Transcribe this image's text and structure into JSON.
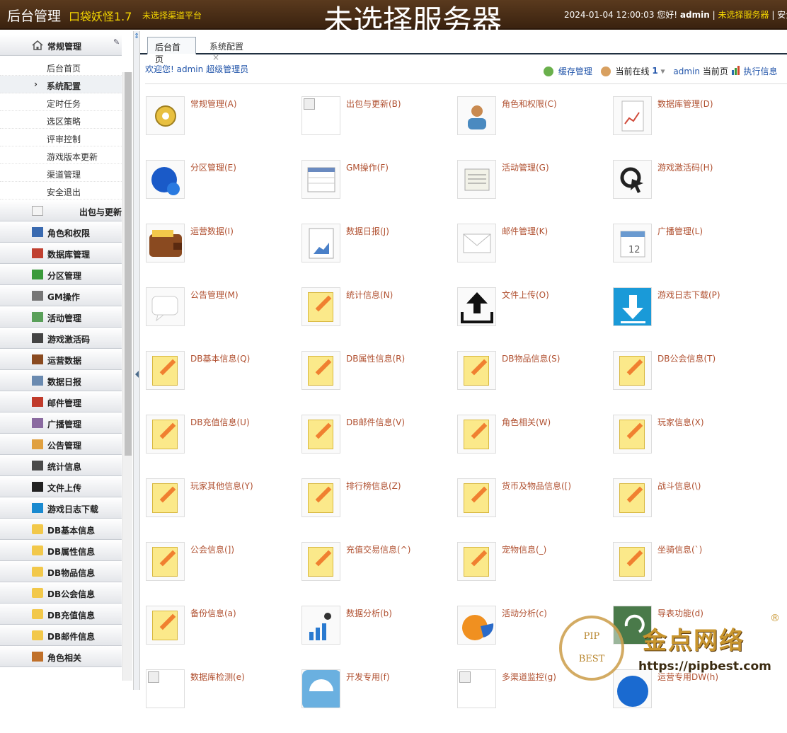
{
  "header": {
    "title": "后台管理",
    "game": "口袋妖怪1.7",
    "channel": "未选择渠道平台",
    "server": "未选择服务器",
    "datetime": "2024-01-04 12:00:03",
    "greeting": "您好!",
    "user": "admin",
    "server_link": "未选择服务器",
    "safe_exit": "安全退"
  },
  "sidebar": {
    "top_group": {
      "label": "常规管理",
      "icon": "home-icon"
    },
    "sub_items": [
      {
        "label": "后台首页",
        "active": false
      },
      {
        "label": "系统配置",
        "active": true
      },
      {
        "label": "定时任务",
        "active": false
      },
      {
        "label": "选区策略",
        "active": false
      },
      {
        "label": "评审控制",
        "active": false
      },
      {
        "label": "游戏版本更新",
        "active": false
      },
      {
        "label": "渠道管理",
        "active": false
      },
      {
        "label": "安全退出",
        "active": false
      }
    ],
    "groups": [
      {
        "label": "出包与更新",
        "icon": "broken-image-icon"
      },
      {
        "label": "角色和权限",
        "icon": "monitor-icon"
      },
      {
        "label": "数据库管理",
        "icon": "database-icon"
      },
      {
        "label": "分区管理",
        "icon": "upload-icon"
      },
      {
        "label": "GM操作",
        "icon": "gm-icon"
      },
      {
        "label": "活动管理",
        "icon": "activity-icon"
      },
      {
        "label": "游戏激活码",
        "icon": "search-icon"
      },
      {
        "label": "运营数据",
        "icon": "wallet-icon"
      },
      {
        "label": "数据日报",
        "icon": "report-icon"
      },
      {
        "label": "邮件管理",
        "icon": "mail-icon"
      },
      {
        "label": "广播管理",
        "icon": "speaker-icon"
      },
      {
        "label": "公告管理",
        "icon": "notice-icon"
      },
      {
        "label": "统计信息",
        "icon": "stats-icon"
      },
      {
        "label": "文件上传",
        "icon": "file-upload-icon"
      },
      {
        "label": "游戏日志下载",
        "icon": "download-icon"
      },
      {
        "label": "DB基本信息",
        "icon": "folder-icon"
      },
      {
        "label": "DB属性信息",
        "icon": "folder-icon"
      },
      {
        "label": "DB物品信息",
        "icon": "folder-icon"
      },
      {
        "label": "DB公会信息",
        "icon": "folder-icon"
      },
      {
        "label": "DB充值信息",
        "icon": "folder-icon"
      },
      {
        "label": "DB邮件信息",
        "icon": "folder-icon"
      },
      {
        "label": "角色相关",
        "icon": "pencil-icon"
      }
    ]
  },
  "tabs": {
    "active": "后台首页",
    "other": "系统配置",
    "close": "×"
  },
  "welcome": {
    "text": "欢迎您!",
    "user": "admin",
    "role": "超级管理员"
  },
  "toolbar": {
    "cache": "缓存管理",
    "online_label": "当前在线",
    "online_count": "1",
    "admin": "admin",
    "current_page": "当前页",
    "exec_info": "执行信息"
  },
  "grid": [
    {
      "label": "常规管理(A)",
      "icon": "gears-icon"
    },
    {
      "label": "出包与更新(B)",
      "icon": "broken-image-icon"
    },
    {
      "label": "角色和权限(C)",
      "icon": "user-icon"
    },
    {
      "label": "数据库管理(D)",
      "icon": "document-chart-icon"
    },
    {
      "label": "分区管理(E)",
      "icon": "globe-icon"
    },
    {
      "label": "GM操作(F)",
      "icon": "table-icon"
    },
    {
      "label": "活动管理(G)",
      "icon": "newspaper-icon"
    },
    {
      "label": "游戏激活码(H)",
      "icon": "cursor-icon"
    },
    {
      "label": "运营数据(I)",
      "icon": "wallet-icon"
    },
    {
      "label": "数据日报(J)",
      "icon": "report-icon"
    },
    {
      "label": "邮件管理(K)",
      "icon": "envelope-icon"
    },
    {
      "label": "广播管理(L)",
      "icon": "calendar-icon"
    },
    {
      "label": "公告管理(M)",
      "icon": "chat-icon"
    },
    {
      "label": "统计信息(N)",
      "icon": "note-icon"
    },
    {
      "label": "文件上传(O)",
      "icon": "upload-icon"
    },
    {
      "label": "游戏日志下载(P)",
      "icon": "download-icon"
    },
    {
      "label": "DB基本信息(Q)",
      "icon": "note-icon"
    },
    {
      "label": "DB属性信息(R)",
      "icon": "note-icon"
    },
    {
      "label": "DB物品信息(S)",
      "icon": "note-icon"
    },
    {
      "label": "DB公会信息(T)",
      "icon": "note-icon"
    },
    {
      "label": "DB充值信息(U)",
      "icon": "note-icon"
    },
    {
      "label": "DB邮件信息(V)",
      "icon": "note-icon"
    },
    {
      "label": "角色相关(W)",
      "icon": "note-icon"
    },
    {
      "label": "玩家信息(X)",
      "icon": "note-icon"
    },
    {
      "label": "玩家其他信息(Y)",
      "icon": "note-icon"
    },
    {
      "label": "排行榜信息(Z)",
      "icon": "note-icon"
    },
    {
      "label": "货币及物品信息([)",
      "icon": "note-icon"
    },
    {
      "label": "战斗信息(\\)",
      "icon": "note-icon"
    },
    {
      "label": "公会信息(])",
      "icon": "note-icon"
    },
    {
      "label": "充值交易信息(^)",
      "icon": "note-icon"
    },
    {
      "label": "宠物信息(_)",
      "icon": "note-icon"
    },
    {
      "label": "坐骑信息(`)",
      "icon": "note-icon"
    },
    {
      "label": "备份信息(a)",
      "icon": "note-icon"
    },
    {
      "label": "数据分析(b)",
      "icon": "stats-person-icon"
    },
    {
      "label": "活动分析(c)",
      "icon": "pie-icon"
    },
    {
      "label": "导表功能(d)",
      "icon": "export-icon"
    },
    {
      "label": "数据库检测(e)",
      "icon": "broken-image-icon"
    },
    {
      "label": "开发专用(f)",
      "icon": "umbrella-icon"
    },
    {
      "label": "多渠道监控(g)",
      "icon": "broken-image-icon"
    },
    {
      "label": "运营专用DW(h)",
      "icon": "tools-icon"
    }
  ],
  "watermark": {
    "seal_top": "PIP",
    "seal_bottom": "BEST",
    "name": "金点网络",
    "url": "https://pipbest.com",
    "reg": "®"
  }
}
